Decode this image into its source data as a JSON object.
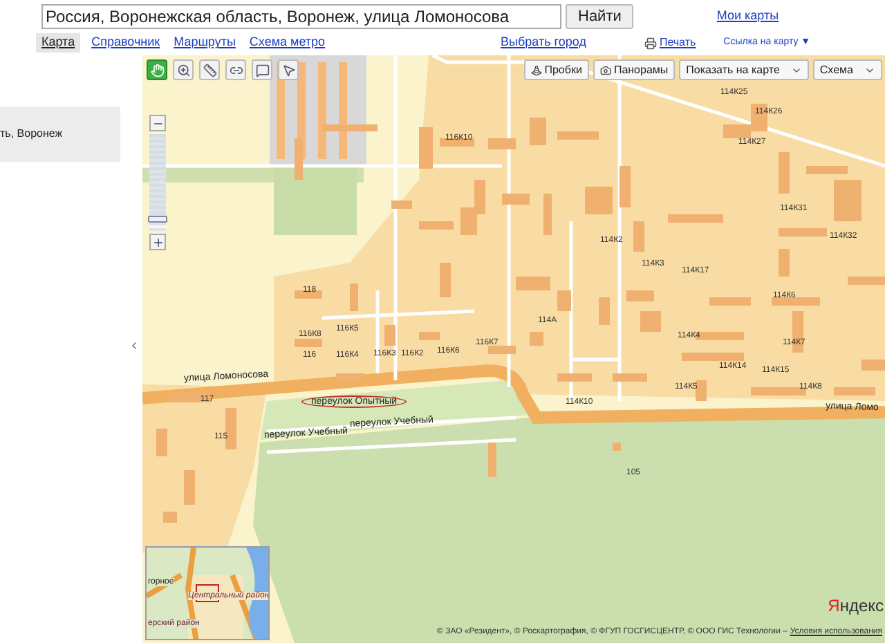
{
  "search": {
    "value": "Россия, Воронежская область, Воронеж, улица Ломоносова",
    "button": "Найти"
  },
  "my_maps": "Мои карты",
  "tabs": [
    {
      "label": "Карта",
      "selected": true
    },
    {
      "label": "Справочник",
      "selected": false
    },
    {
      "label": "Маршруты",
      "selected": false
    },
    {
      "label": "Схема метро",
      "selected": false
    }
  ],
  "choose_city": "Выбрать город",
  "print": "Печать",
  "map_link": "Ссылка на карту ▼",
  "sidebar": {
    "result": "ть, Воронеж"
  },
  "tools": [
    {
      "selected": true
    },
    {
      "selected": false
    },
    {
      "selected": false
    },
    {
      "selected": false
    },
    {
      "selected": false
    },
    {
      "selected": false
    }
  ],
  "layer_buttons": [
    {
      "label": "Пробки",
      "kind": "toggle"
    },
    {
      "label": "Панорамы",
      "kind": "toggle"
    },
    {
      "label": "Показать на карте",
      "kind": "dropdown"
    },
    {
      "label": "Схема",
      "kind": "dropdown"
    }
  ],
  "zoom": {
    "level": 0.9
  },
  "map": {
    "labels": [
      {
        "text": "116К10",
        "kind": "house"
      },
      {
        "text": "114К25",
        "kind": "house"
      },
      {
        "text": "114К26",
        "kind": "house"
      },
      {
        "text": "114К27",
        "kind": "house"
      },
      {
        "text": "114К31",
        "kind": "house"
      },
      {
        "text": "114К32",
        "kind": "house"
      },
      {
        "text": "114К2",
        "kind": "house"
      },
      {
        "text": "114К3",
        "kind": "house"
      },
      {
        "text": "114К17",
        "kind": "house"
      },
      {
        "text": "114К6",
        "kind": "house"
      },
      {
        "text": "114А",
        "kind": "house"
      },
      {
        "text": "114К4",
        "kind": "house"
      },
      {
        "text": "114К7",
        "kind": "house"
      },
      {
        "text": "114К14",
        "kind": "house"
      },
      {
        "text": "114К15",
        "kind": "house"
      },
      {
        "text": "114К5",
        "kind": "house"
      },
      {
        "text": "114К8",
        "kind": "house"
      },
      {
        "text": "114К10",
        "kind": "house"
      },
      {
        "text": "118",
        "kind": "house"
      },
      {
        "text": "116К8",
        "kind": "house"
      },
      {
        "text": "116К5",
        "kind": "house"
      },
      {
        "text": "116",
        "kind": "house"
      },
      {
        "text": "116К4",
        "kind": "house"
      },
      {
        "text": "116К3",
        "kind": "house"
      },
      {
        "text": "116К2",
        "kind": "house"
      },
      {
        "text": "116К6",
        "kind": "house"
      },
      {
        "text": "116К7",
        "kind": "house"
      },
      {
        "text": "117",
        "kind": "house"
      },
      {
        "text": "115",
        "kind": "house"
      },
      {
        "text": "105",
        "kind": "house"
      },
      {
        "text": "улица Ломоносова",
        "kind": "street"
      },
      {
        "text": "улица Ломо",
        "kind": "street"
      },
      {
        "text": "переулок Опытный",
        "kind": "highlighted"
      },
      {
        "text": "переулок Учебный",
        "kind": "street"
      },
      {
        "text": "переулок Учебный",
        "kind": "street"
      }
    ]
  },
  "minimap": {
    "labels": [
      "горное",
      "Центральный район",
      "ерский район"
    ]
  },
  "logo": "Яндекс",
  "copyright": "© ЗАО «Резидент», © Роскартография, © ФГУП ГОСГИСЦЕНТР, © ООО ГИС Технологии –",
  "terms_link": "Условия использования"
}
